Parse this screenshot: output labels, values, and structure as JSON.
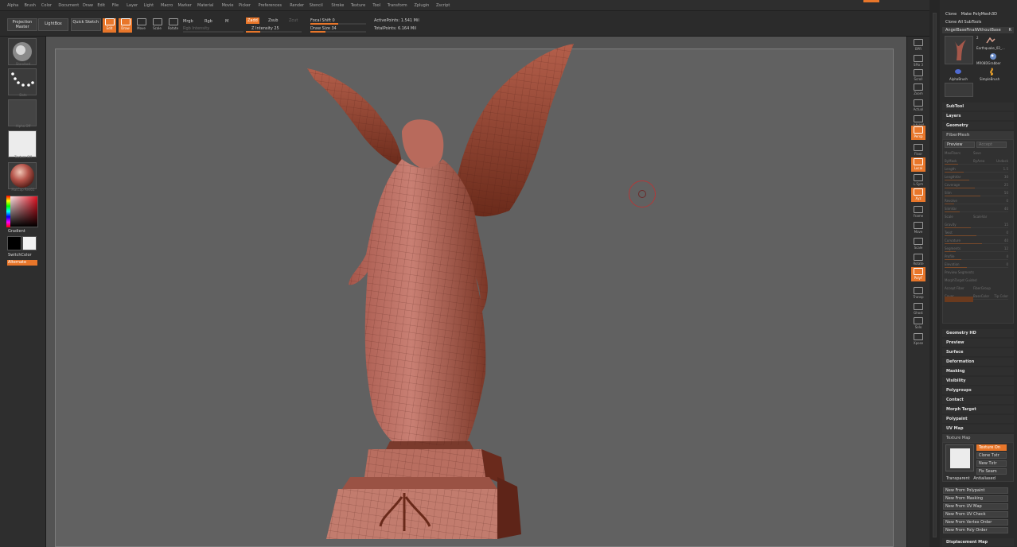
{
  "menu": [
    "Alpha",
    "Brush",
    "Color",
    "Document",
    "Draw",
    "Edit",
    "File",
    "Layer",
    "Light",
    "Macro",
    "Marker",
    "Material",
    "Movie",
    "Picker",
    "Preferences",
    "Render",
    "Stencil",
    "Stroke",
    "Texture",
    "Tool",
    "Transform",
    "Zplugin",
    "Zscript"
  ],
  "toolbar": {
    "projection_master": "Projection Master",
    "lightbox": "LightBox",
    "quick_sketch": "Quick Sketch",
    "edit": "Edit",
    "draw": "Draw",
    "move": "Move",
    "scale": "Scale",
    "rotate": "Rotate",
    "mrgb": "Mrgb",
    "rgb": "Rgb",
    "m": "M",
    "rgb_intensity": "Rgb Intensity",
    "zadd": "Zadd",
    "zsub": "Zsub",
    "zcut": "Zcut",
    "z_intensity": "Z Intensity 25",
    "focal_shift": "Focal Shift 0",
    "draw_size": "Draw Size 34",
    "active_points": "ActivePoints: 1.541 Mil",
    "total_points": "TotalPoints: 6.164 Mil",
    "z_intensity_value": 25,
    "draw_size_value": 34,
    "focal_shift_value": 0
  },
  "left_shelf": {
    "brush": "Standard",
    "stroke": "Dots",
    "alpha": "Alpha Off",
    "texture": "Texture Off",
    "material": "MatCap Red01",
    "gradient": "Gradient",
    "switch_color": "SwitchColor",
    "alternate": "Alternate"
  },
  "right_shelf": [
    "BPR",
    "SPix 3",
    "Scroll",
    "Zoom",
    "Actual",
    "AAHalf",
    "Persp",
    "Floor",
    "Local",
    "L.Sym",
    "Xyz",
    "Frame",
    "Move",
    "Scale",
    "Rotate",
    "PolyF",
    "Transp",
    "Ghost",
    "Solo",
    "Xpose"
  ],
  "right_panel": {
    "clone": "Clone",
    "make_polymesh": "Make PolyMesh3D",
    "clone_all": "Clone All SubTools",
    "current_tool": "AngelBaseFinalWithoutBase",
    "r_label": "R",
    "tool_count": "2",
    "subtool_thumbs": [
      "Earthquake_02_...",
      "MR08DGrabber",
      "AlphaBrush",
      "SimpleBrush"
    ],
    "subtool": "SubTool",
    "layers": "Layers",
    "geometry": "Geometry",
    "fibermesh": "FiberMesh",
    "fm_preview": "Preview",
    "fm_accept": "Accept",
    "fm_rows": [
      [
        "MaxFibers",
        "Save"
      ],
      [
        "ByMask",
        "ByArea",
        "Undock"
      ],
      [
        "Length",
        "",
        "1.5"
      ],
      [
        "LengthVar",
        "",
        "30"
      ],
      [
        "Coverage",
        "",
        "25"
      ],
      [
        "Slim",
        "",
        "50"
      ],
      [
        "Revolve",
        "",
        "0"
      ],
      [
        "SlimVar",
        "",
        "40"
      ],
      [
        "Scale",
        "ScaleVar"
      ],
      [
        "Gravity",
        "",
        "15"
      ],
      [
        "Twist",
        "",
        "0"
      ],
      [
        "Curvature",
        "",
        "40"
      ],
      [
        "Segments",
        "",
        "12"
      ],
      [
        "Profile",
        "",
        "4"
      ],
      [
        "Elevation",
        "",
        "0"
      ],
      [
        "Preview Segments"
      ],
      [
        "MorphTarget Guided"
      ],
      [
        "Accept Fiber",
        "FiberGroup"
      ],
      [
        "Cover",
        "BaseColor",
        "Tip Color"
      ]
    ],
    "geometry_hd": "Geometry HD",
    "preview": "Preview",
    "surface": "Surface",
    "deformation": "Deformation",
    "masking": "Masking",
    "visibility": "Visibility",
    "polygroups": "Polygroups",
    "contact": "Contact",
    "morph_target": "Morph Target",
    "polypaint": "Polypaint",
    "uv_map": "UV Map",
    "texture_map": "Texture Map",
    "texture_on": "Texture On",
    "clone_txtr": "Clone Txtr",
    "new_txtr": "New Txtr",
    "fix_seam": "Fix Seam",
    "transparent": "Transparent",
    "antialiased": "Antialiased",
    "new_from_polypaint": "New From Polypaint",
    "new_from_masking": "New From Masking",
    "new_from_uv_map": "New From UV Map",
    "new_from_uv_check": "New From UV Check",
    "new_from_vertex_order": "New From Vertex Order",
    "new_from_poly_order": "New From Poly Order",
    "displacement_map": "Displacement Map"
  },
  "colors": {
    "accent": "#e8762a",
    "canvas": "#535353",
    "doc": "#616161",
    "model": "#c07266",
    "model_dark": "#6e2a1c"
  }
}
